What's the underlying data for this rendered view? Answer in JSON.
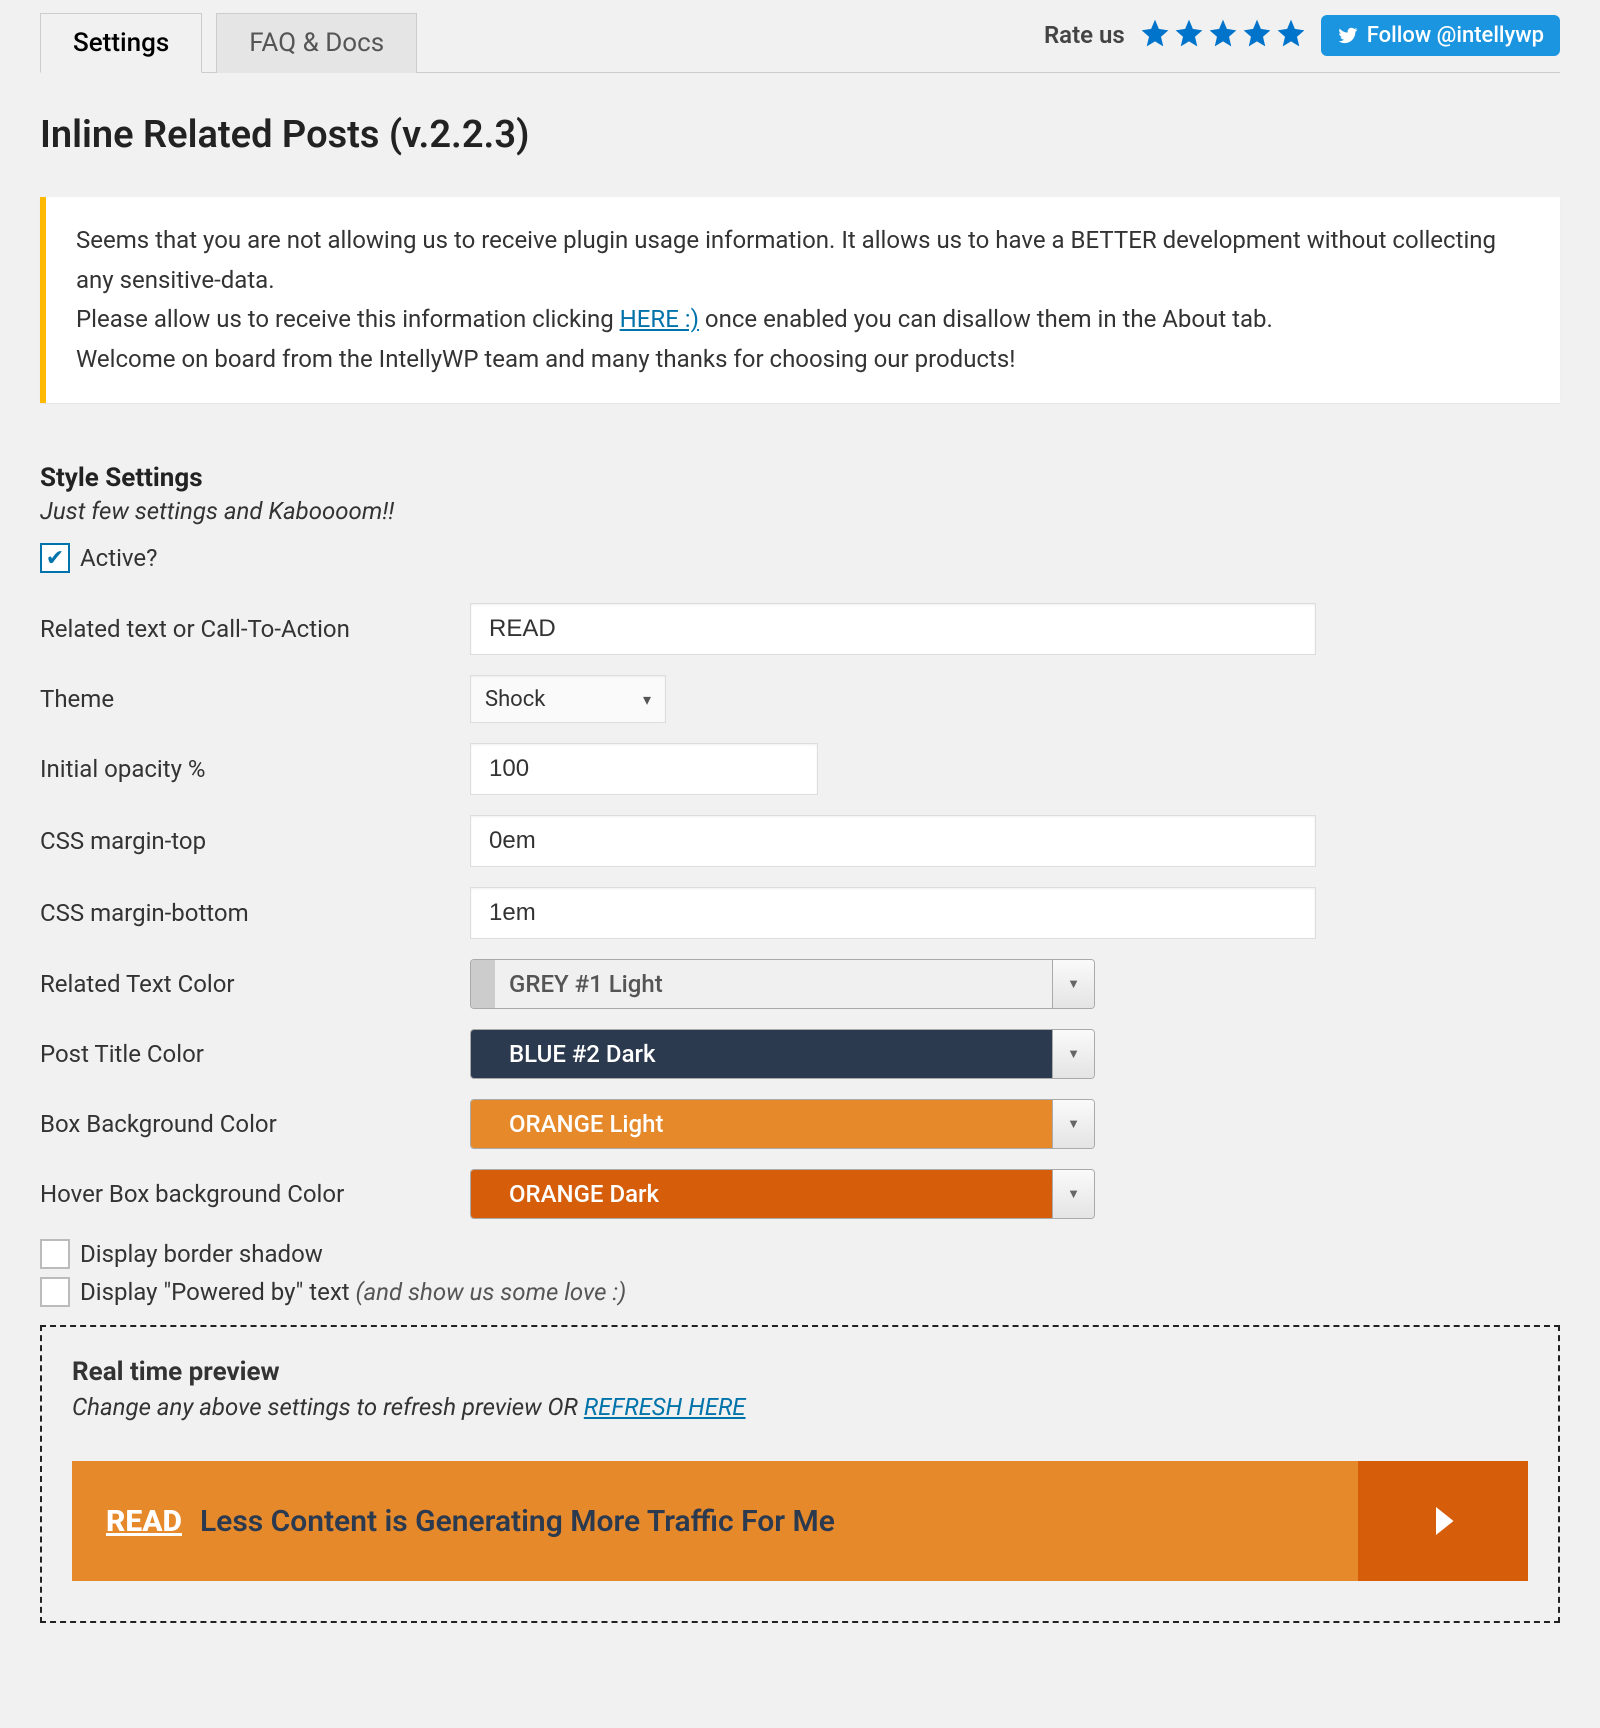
{
  "tabs": {
    "settings": "Settings",
    "faq": "FAQ & Docs"
  },
  "rateus": "Rate us",
  "follow": "Follow @intellywp",
  "page_title": "Inline Related Posts (v.2.2.3)",
  "notice": {
    "l1a": "Seems that you are not allowing us to receive plugin usage information. It allows us to have a BETTER development without collecting any sensitive-data.",
    "l2a": "Please allow us to receive this information clicking ",
    "l2link": "HERE :)",
    "l2b": " once enabled you can disallow them in the About tab.",
    "l3": "Welcome on board from the IntellyWP team and many thanks for choosing our products!"
  },
  "style": {
    "heading": "Style Settings",
    "sub": "Just few settings and Kaboooom!!",
    "active_label": "Active?",
    "rows": {
      "cta_label": "Related text or Call-To-Action",
      "cta_value": "READ",
      "theme_label": "Theme",
      "theme_value": "Shock",
      "opacity_label": "Initial opacity %",
      "opacity_value": "100",
      "mtop_label": "CSS margin-top",
      "mtop_value": "0em",
      "mbot_label": "CSS margin-bottom",
      "mbot_value": "1em",
      "rel_color_label": "Related Text Color",
      "rel_color_value": "GREY #1 Light",
      "title_color_label": "Post Title Color",
      "title_color_value": "BLUE #2 Dark",
      "box_bg_label": "Box Background Color",
      "box_bg_value": "ORANGE Light",
      "hover_bg_label": "Hover Box background Color",
      "hover_bg_value": "ORANGE Dark"
    },
    "shadow_label": "Display border shadow",
    "powered_label": "Display \"Powered by\" text ",
    "powered_em": "(and show us some love :)"
  },
  "preview": {
    "heading": "Real time preview",
    "sub_a": "Change any above settings to refresh preview OR ",
    "sub_link": "REFRESH HERE",
    "read": "READ",
    "title": "Less Content is Generating More Traffic For Me"
  },
  "colors": {
    "rel_swatch": "#cccccc",
    "rel_bg": "#f0f0f0",
    "rel_text": "#555",
    "title_swatch": "#2b3a4f",
    "title_bg": "#2b3a4f",
    "box_swatch": "#e6892b",
    "box_bg": "#e6892b",
    "hover_swatch": "#d65d0a",
    "hover_bg": "#d65d0a"
  }
}
